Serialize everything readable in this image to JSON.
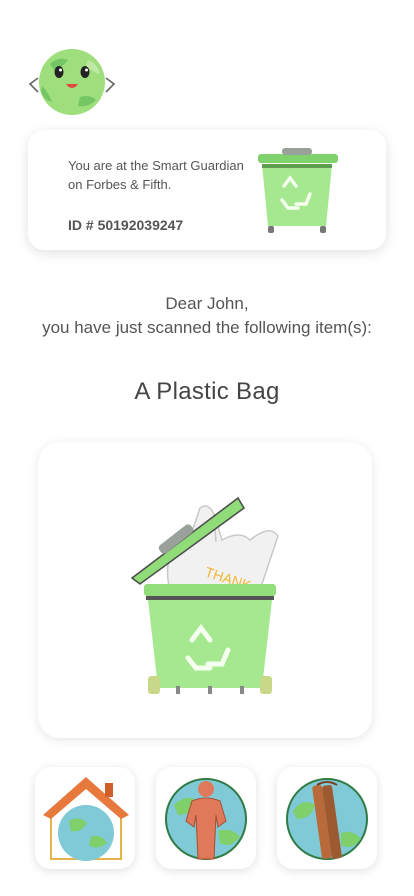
{
  "location_card": {
    "message": "You are at the Smart Guardian on Forbes & Fifth.",
    "id_label": "ID # 50192039247"
  },
  "greeting": {
    "line1": "Dear John,",
    "line2": "you have just scanned the following item(s):"
  },
  "item": {
    "title": "A Plastic Bag",
    "bag_print": "THANK"
  },
  "icons": {
    "mascot": "smiling-globe-icon",
    "card_bin": "recycling-bin-icon",
    "item_image": "recycling-bin-with-plastic-bag-icon",
    "badges": [
      "earth-house-icon",
      "earth-person-icon",
      "earth-cinnamon-icon"
    ]
  },
  "colors": {
    "bin_green": "#9de58a",
    "bin_dark": "#5fae4e",
    "earth_blue": "#7fcad6",
    "earth_green": "#7fcf6a",
    "roof_orange": "#e8793d",
    "person_orange": "#e0795a",
    "cinnamon_brown": "#b86a3a"
  }
}
